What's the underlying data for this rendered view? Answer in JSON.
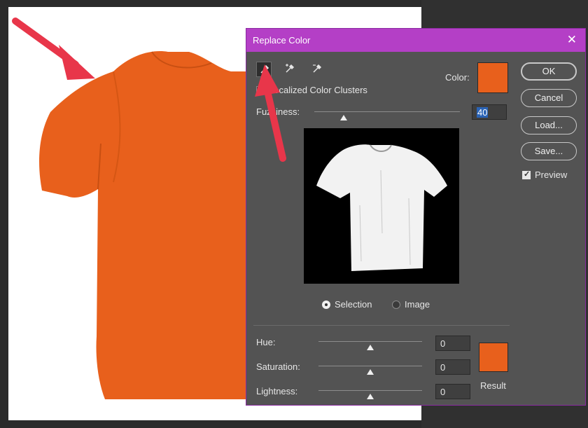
{
  "dialog": {
    "title": "Replace Color",
    "close_icon": "close-icon",
    "tools": [
      "eyedropper-icon",
      "eyedropper-plus-icon",
      "eyedropper-minus-icon"
    ],
    "localized_clusters_label": "Localized Color Clusters",
    "localized_clusters_checked": false,
    "color_label": "Color:",
    "selected_color": "#e8601c",
    "fuzziness_label": "Fuzziness:",
    "fuzziness_value": "40",
    "selection_label": "Selection",
    "image_label": "Image",
    "selection_mode": "Selection",
    "hue_label": "Hue:",
    "hue_value": "0",
    "saturation_label": "Saturation:",
    "saturation_value": "0",
    "lightness_label": "Lightness:",
    "lightness_value": "0",
    "result_label": "Result",
    "result_color": "#e8601c"
  },
  "buttons": {
    "ok": "OK",
    "cancel": "Cancel",
    "load": "Load...",
    "save": "Save..."
  },
  "preview_option": {
    "label": "Preview",
    "checked": true
  },
  "colors": {
    "titlebar": "#b43fc6",
    "dialog_bg": "#535353",
    "shirt": "#e8601c",
    "annotation_arrow": "#e8364a"
  }
}
